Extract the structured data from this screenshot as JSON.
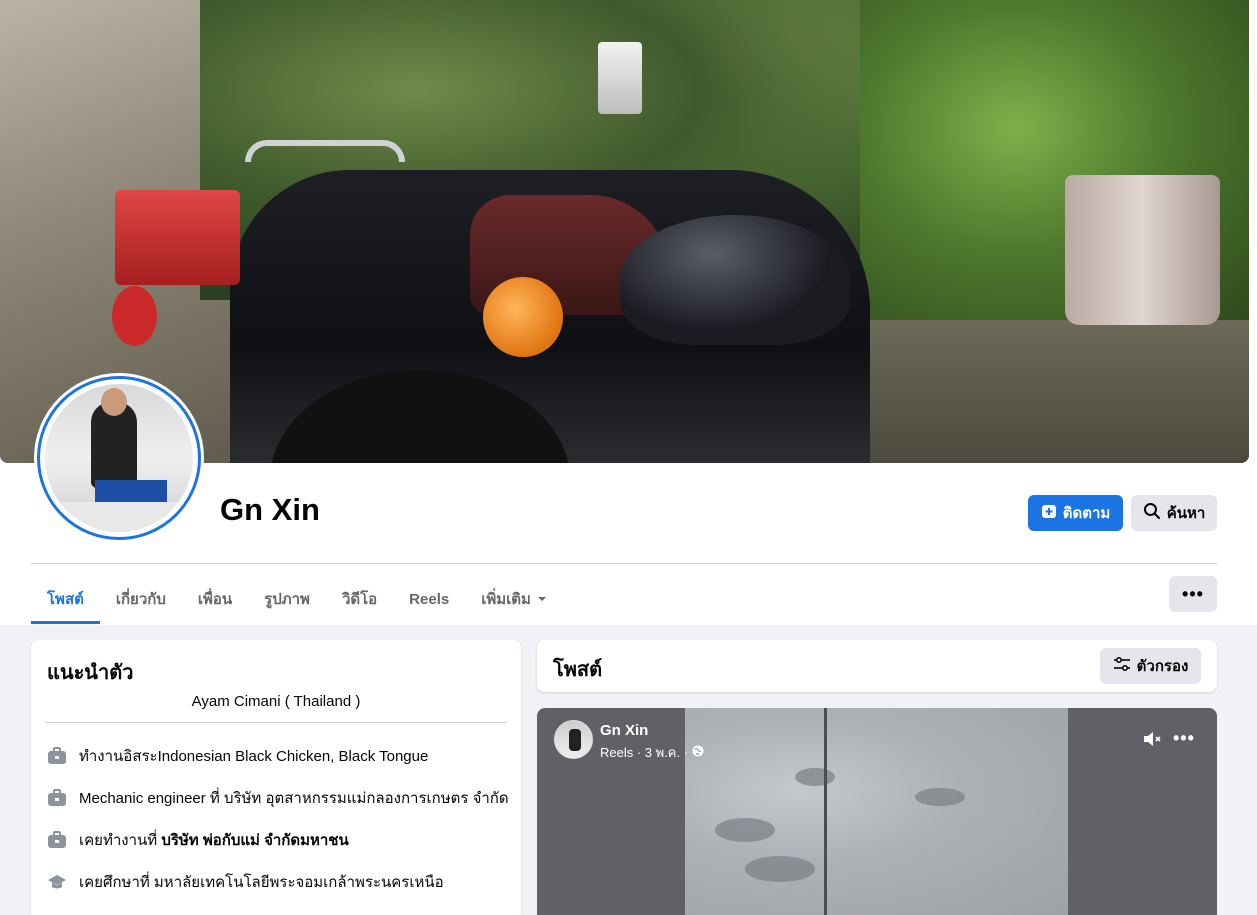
{
  "profile": {
    "name": "Gn Xin",
    "follow_label": "ติดตาม",
    "search_label": "ค้นหา"
  },
  "tabs": [
    {
      "label": "โพสต์",
      "active": true
    },
    {
      "label": "เกี่ยวกับ"
    },
    {
      "label": "เพื่อน"
    },
    {
      "label": "รูปภาพ"
    },
    {
      "label": "วิดีโอ"
    },
    {
      "label": "Reels"
    },
    {
      "label": "เพิ่มเติม"
    }
  ],
  "more_label": "•••",
  "intro": {
    "title": "แนะนำตัว",
    "bio": "Ayam Cimani ( Thailand )",
    "items": [
      {
        "icon": "briefcase-icon",
        "prefix": "ทำงานอิสระIndonesian Black Chicken, Black Tongue",
        "bold": ""
      },
      {
        "icon": "briefcase-icon",
        "prefix": "Mechanic engineer ที่ บริษัท อุตสาหกรรมแม่กลองการเกษตร จำกัด",
        "bold": ""
      },
      {
        "icon": "briefcase-icon",
        "prefix": "เคยทำงานที่ ",
        "bold": "บริษัท พ่อกับแม่ จำกัดมหาชน"
      },
      {
        "icon": "graduation-cap-icon",
        "prefix": "เคยศึกษาที่ มหาลัยเทคโนโลยีพระจอมเกล้าพระนครเหนือ",
        "bold": ""
      }
    ]
  },
  "posts": {
    "title": "โพสต์",
    "filter_label": "ตัวกรอง"
  },
  "reel_post": {
    "author": "Gn Xin",
    "meta": "Reels · 3 พ.ค. ·",
    "menu": "•••"
  },
  "colors": {
    "accent": "#1b74e4",
    "page_bg": "#f0f2f5",
    "secondary_button": "#e4e6eb"
  }
}
